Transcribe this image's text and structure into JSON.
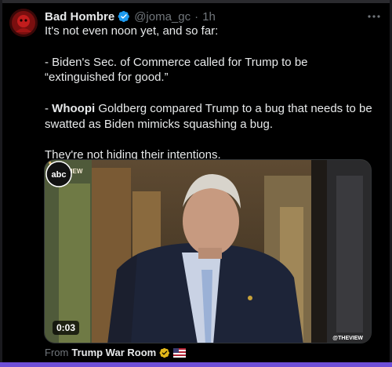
{
  "tweet": {
    "author_name": "Bad Hombre",
    "handle": "@joma_gc",
    "separator": "·",
    "time": "1h",
    "lines": {
      "intro": "It's not even noon yet, and so far:",
      "point1": "- Biden's Sec. of Commerce called for Trump to be “extinguished for good.”",
      "point2_prefix": "- ",
      "point2_bold": "Whoopi",
      "point2_rest": " Goldberg compared Trump to a bug that needs to be swatted as Biden mimicks squashing a bug.",
      "closing": "They're not hiding their intentions."
    },
    "icons": {
      "verified": "verified-badge-icon",
      "more": "more-options-icon"
    }
  },
  "media": {
    "duration": "0:03",
    "channel_logo_text": "abc",
    "channel_subtext": "@THEVIEW",
    "show_logo_text": "VIEW"
  },
  "source": {
    "prefix": "From",
    "name": "Trump War Room",
    "icons": [
      "gold-verified-badge-icon",
      "flag-icon"
    ]
  },
  "colors": {
    "background": "#000000",
    "text": "#e7e9ea",
    "muted": "#71767b",
    "verified_blue": "#1d9bf0",
    "verified_gold": "#e2b719",
    "accent_bar": "#6e4fd8"
  }
}
